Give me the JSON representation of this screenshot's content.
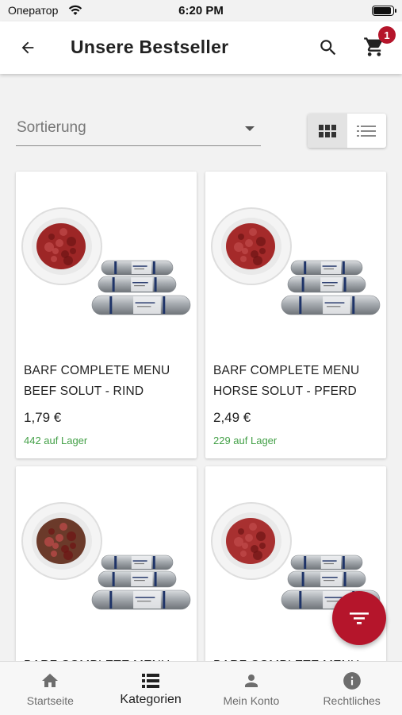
{
  "status_bar": {
    "carrier": "Оператор",
    "time": "6:20 PM"
  },
  "app_bar": {
    "title": "Unsere Bestseller",
    "cart_count": "1"
  },
  "sort": {
    "label": "Sortierung"
  },
  "colors": {
    "accent": "#b5152b",
    "stock": "#43a047",
    "app_bar": "#ffffff",
    "background": "#f2f2f2"
  },
  "icons": {
    "back": "arrow-left-icon",
    "search": "search-icon",
    "cart": "shopping-cart-icon",
    "grid_view": "grid-view-icon",
    "list_view": "list-view-icon",
    "filter": "filter-icon"
  },
  "products": [
    {
      "name": "BARF COMPLETE MENU BEEF SOLUT - RIND",
      "price": "1,79 €",
      "stock": "442 auf Lager",
      "meat": "#9d2626"
    },
    {
      "name": "BARF COMPLETE MENU HORSE SOLUT - PFERD",
      "price": "2,49 €",
      "stock": "229 auf Lager",
      "meat": "#a52a2a"
    },
    {
      "name": "BARF COMPLETE MENU",
      "price": "",
      "stock": "",
      "meat": "#6b3a2a"
    },
    {
      "name": "BARF COMPLETE MENU",
      "price": "",
      "stock": "",
      "meat": "#a83030"
    }
  ],
  "bottom_nav": {
    "items": [
      {
        "label": "Startseite",
        "icon": "home-icon"
      },
      {
        "label": "Kategorien",
        "icon": "categories-icon"
      },
      {
        "label": "Mein Konto",
        "icon": "account-icon"
      },
      {
        "label": "Rechtliches",
        "icon": "info-icon"
      }
    ]
  }
}
